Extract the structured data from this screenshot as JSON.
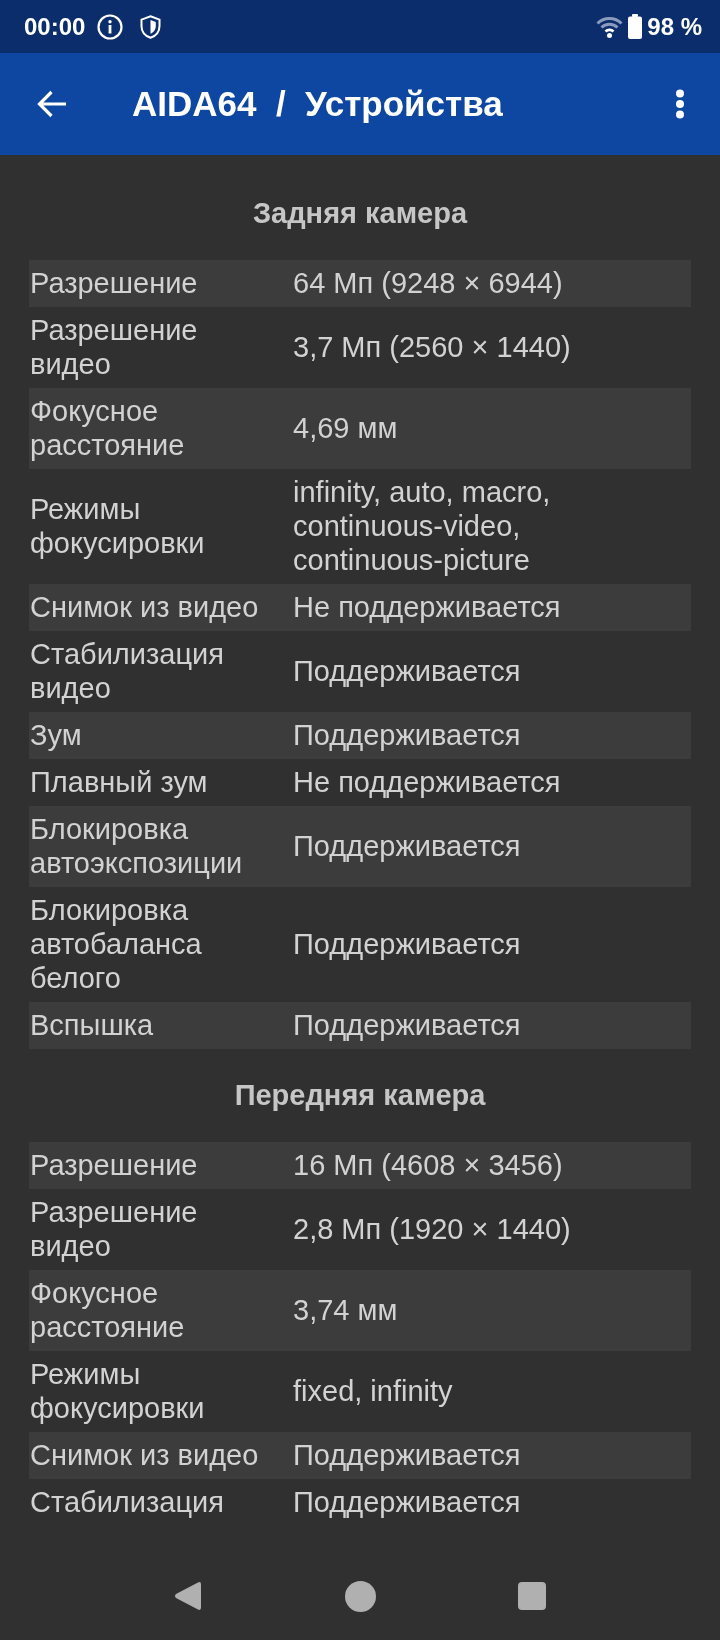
{
  "status_bar": {
    "time": "00:00",
    "battery": "98 %"
  },
  "app_bar": {
    "title": "AIDA64  /  Устройства"
  },
  "sections": [
    {
      "title": "Задняя камера",
      "rows": [
        {
          "label": "Разрешение",
          "value": "64 Мп (9248 × 6944)"
        },
        {
          "label": "Разрешение видео",
          "value": "3,7 Мп (2560 × 1440)"
        },
        {
          "label": "Фокусное расстояние",
          "value": "4,69 мм"
        },
        {
          "label": "Режимы фокусировки",
          "value": "infinity, auto, macro, continuous-video, continuous-picture"
        },
        {
          "label": "Снимок из видео",
          "value": "Не поддерживается"
        },
        {
          "label": "Стабилизация видео",
          "value": "Поддерживается"
        },
        {
          "label": "Зум",
          "value": "Поддерживается"
        },
        {
          "label": "Плавный зум",
          "value": "Не поддерживается"
        },
        {
          "label": "Блокировка автоэкспозиции",
          "value": "Поддерживается"
        },
        {
          "label": "Блокировка автобаланса белого",
          "value": "Поддерживается"
        },
        {
          "label": "Вспышка",
          "value": "Поддерживается"
        }
      ]
    },
    {
      "title": "Передняя камера",
      "rows": [
        {
          "label": "Разрешение",
          "value": "16 Мп (4608 × 3456)"
        },
        {
          "label": "Разрешение видео",
          "value": "2,8 Мп (1920 × 1440)"
        },
        {
          "label": "Фокусное расстояние",
          "value": "3,74 мм"
        },
        {
          "label": "Режимы фокусировки",
          "value": "fixed, infinity"
        },
        {
          "label": "Снимок из видео",
          "value": "Поддерживается"
        },
        {
          "label": "Стабилизация",
          "value": "Поддерживается"
        }
      ]
    }
  ]
}
